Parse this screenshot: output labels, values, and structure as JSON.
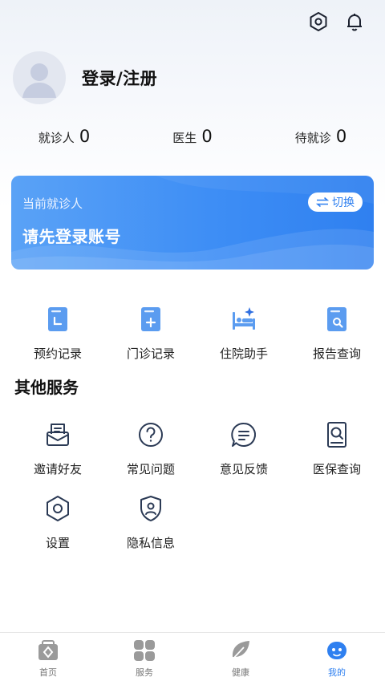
{
  "header": {
    "settings_icon": "hexagon-settings-icon",
    "notification_icon": "bell-icon"
  },
  "profile": {
    "login_label": "登录/注册"
  },
  "stats": [
    {
      "label": "就诊人",
      "value": "0"
    },
    {
      "label": "医生",
      "value": "0"
    },
    {
      "label": "待就诊",
      "value": "0"
    }
  ],
  "patient_card": {
    "subtitle": "当前就诊人",
    "title": "请先登录账号",
    "switch_label": "切换",
    "colors": {
      "start": "#5aa2f6",
      "end": "#2f80f0"
    }
  },
  "quick_actions": [
    {
      "label": "预约记录",
      "icon": "appointment-record-icon"
    },
    {
      "label": "门诊记录",
      "icon": "outpatient-record-icon"
    },
    {
      "label": "住院助手",
      "icon": "hospital-bed-icon"
    },
    {
      "label": "报告查询",
      "icon": "report-search-icon"
    }
  ],
  "other_services": {
    "title": "其他服务",
    "items": [
      {
        "label": "邀请好友",
        "icon": "invite-mail-icon"
      },
      {
        "label": "常见问题",
        "icon": "question-icon"
      },
      {
        "label": "意见反馈",
        "icon": "feedback-chat-icon"
      },
      {
        "label": "医保查询",
        "icon": "insurance-search-icon"
      },
      {
        "label": "设置",
        "icon": "settings-icon"
      },
      {
        "label": "隐私信息",
        "icon": "privacy-shield-icon"
      }
    ]
  },
  "tabbar": {
    "active": "我的",
    "tabs": [
      {
        "label": "首页",
        "icon": "home-medkit-icon"
      },
      {
        "label": "服务",
        "icon": "services-grid-icon"
      },
      {
        "label": "健康",
        "icon": "health-leaf-icon"
      },
      {
        "label": "我的",
        "icon": "profile-face-icon"
      }
    ]
  },
  "colors": {
    "accent": "#2f80f0",
    "icon_blue": "#5b9cf0",
    "icon_dark": "#2b3a55"
  }
}
